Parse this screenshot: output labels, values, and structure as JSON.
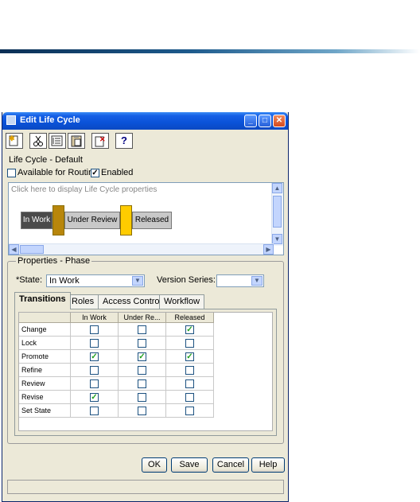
{
  "window": {
    "title": "Edit Life Cycle",
    "lifecycle_label": "Life Cycle - Default",
    "available_for_routing": {
      "label": "Available for Routing",
      "checked": false
    },
    "enabled": {
      "label": "Enabled",
      "checked": true
    }
  },
  "toolbar": {
    "icons": [
      "new-icon",
      "cut-icon",
      "edit-list-icon",
      "paste-icon",
      "delete-icon",
      "help-icon"
    ],
    "help_glyph": "?"
  },
  "canvas": {
    "hint": "Click here to display Life Cycle properties",
    "phases": [
      "In Work",
      "Under Review",
      "Released"
    ]
  },
  "properties": {
    "group_title": "Properties - Phase",
    "state_label": "*State:",
    "state_value": "In Work",
    "version_series_label": "Version Series:",
    "version_series_value": ""
  },
  "tabs": [
    "Transitions",
    "Roles",
    "Access Control",
    "Workflow"
  ],
  "transitions": {
    "columns": [
      "In Work",
      "Under Re...",
      "Released"
    ],
    "rows": [
      {
        "label": "Change",
        "values": [
          false,
          false,
          true
        ]
      },
      {
        "label": "Lock",
        "values": [
          false,
          false,
          false
        ]
      },
      {
        "label": "Promote",
        "values": [
          true,
          true,
          true
        ]
      },
      {
        "label": "Refine",
        "values": [
          false,
          false,
          false
        ]
      },
      {
        "label": "Review",
        "values": [
          false,
          false,
          false
        ]
      },
      {
        "label": "Revise",
        "values": [
          true,
          false,
          false
        ]
      },
      {
        "label": "Set State",
        "values": [
          false,
          false,
          false
        ]
      }
    ]
  },
  "buttons": {
    "ok": "OK",
    "save": "Save",
    "cancel": "Cancel",
    "help": "Help"
  },
  "colors": {
    "in_work_phase": "#4a4a4a",
    "under_review_phase": "#c8c8c8",
    "released_phase": "#c8c8c8",
    "gate_1": "#b8860b",
    "gate_2": "#ffcc00"
  }
}
